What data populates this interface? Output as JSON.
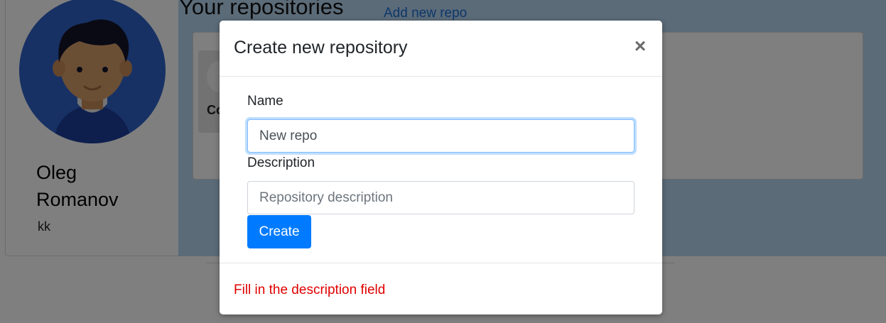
{
  "profile": {
    "name": "Oleg Romanov",
    "bio": "kk"
  },
  "repos": {
    "title": "Your repositories",
    "add_link": "Add new repo",
    "card_text": "Co"
  },
  "modal": {
    "title": "Create new repository",
    "close_symbol": "×",
    "name_label": "Name",
    "name_value": "New repo",
    "description_label": "Description",
    "description_placeholder": "Repository description",
    "description_value": "",
    "create_label": "Create",
    "error_message": "Fill in the description field"
  },
  "colors": {
    "primary": "#007bff",
    "error": "#e00000",
    "panel": "#b7d7f1"
  }
}
